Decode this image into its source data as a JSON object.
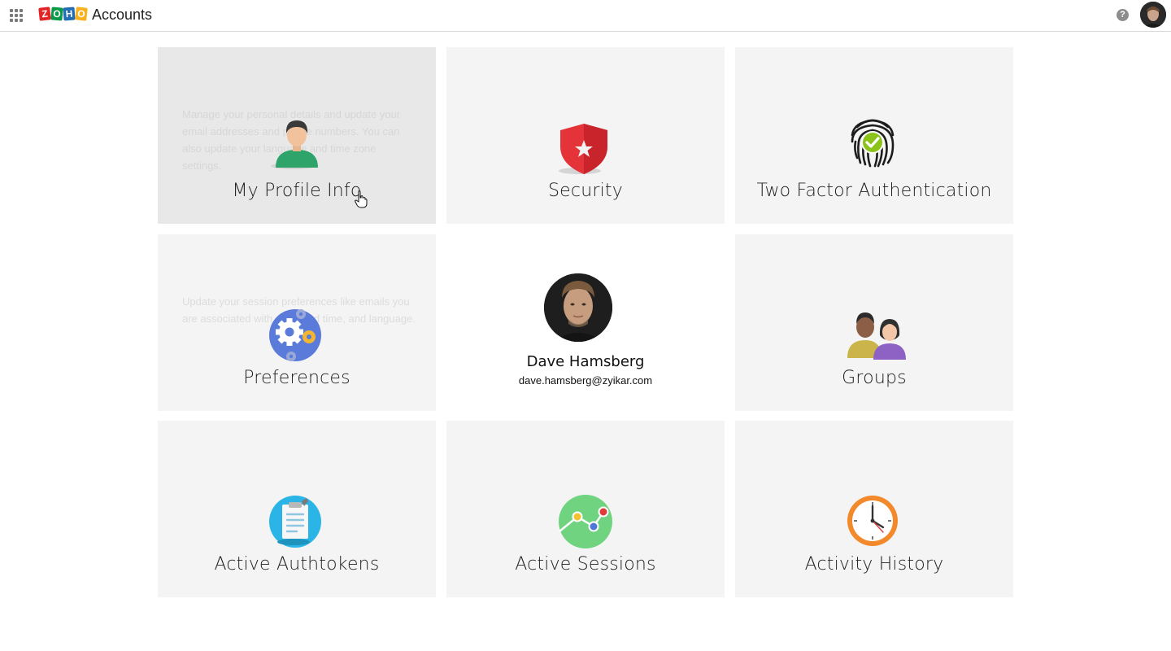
{
  "header": {
    "logo_letters": [
      "Z",
      "O",
      "H",
      "O"
    ],
    "logo_colors": [
      "#e42527",
      "#089949",
      "#226db4",
      "#f9b21d"
    ],
    "title": "Accounts",
    "help_glyph": "?",
    "icons": {
      "apps": "apps-grid-icon",
      "help": "help-icon",
      "avatar": "user-avatar"
    }
  },
  "tiles": [
    {
      "label": "My Profile Info",
      "icon": "person-icon",
      "desc": "Manage your personal details and update your email addresses and phone numbers. You can also update your language and time zone settings."
    },
    {
      "label": "Security",
      "icon": "shield-icon"
    },
    {
      "label": "Two Factor Authentication",
      "icon": "fingerprint-icon"
    },
    {
      "label": "Preferences",
      "icon": "gears-icon",
      "desc": "Update your session preferences like emails you are associated with, date and time, and language."
    },
    {
      "label": "Groups",
      "icon": "group-icon"
    },
    {
      "label": "Active Authtokens",
      "icon": "clipboard-icon"
    },
    {
      "label": "Active Sessions",
      "icon": "sessions-icon"
    },
    {
      "label": "Activity History",
      "icon": "clock-icon"
    }
  ],
  "user": {
    "name": "Dave Hamsberg",
    "email": "dave.hamsberg@zyikar.com"
  },
  "colors": {
    "tile_bg": "#f4f4f4",
    "tile_hover_bg": "#e8e8e8",
    "shield": "#e5333a",
    "check": "#8bc31a",
    "gears": "#5b7bdb",
    "authtoken": "#2bb5e6",
    "sessions": "#6fd37f",
    "clock": "#f28a2c"
  }
}
